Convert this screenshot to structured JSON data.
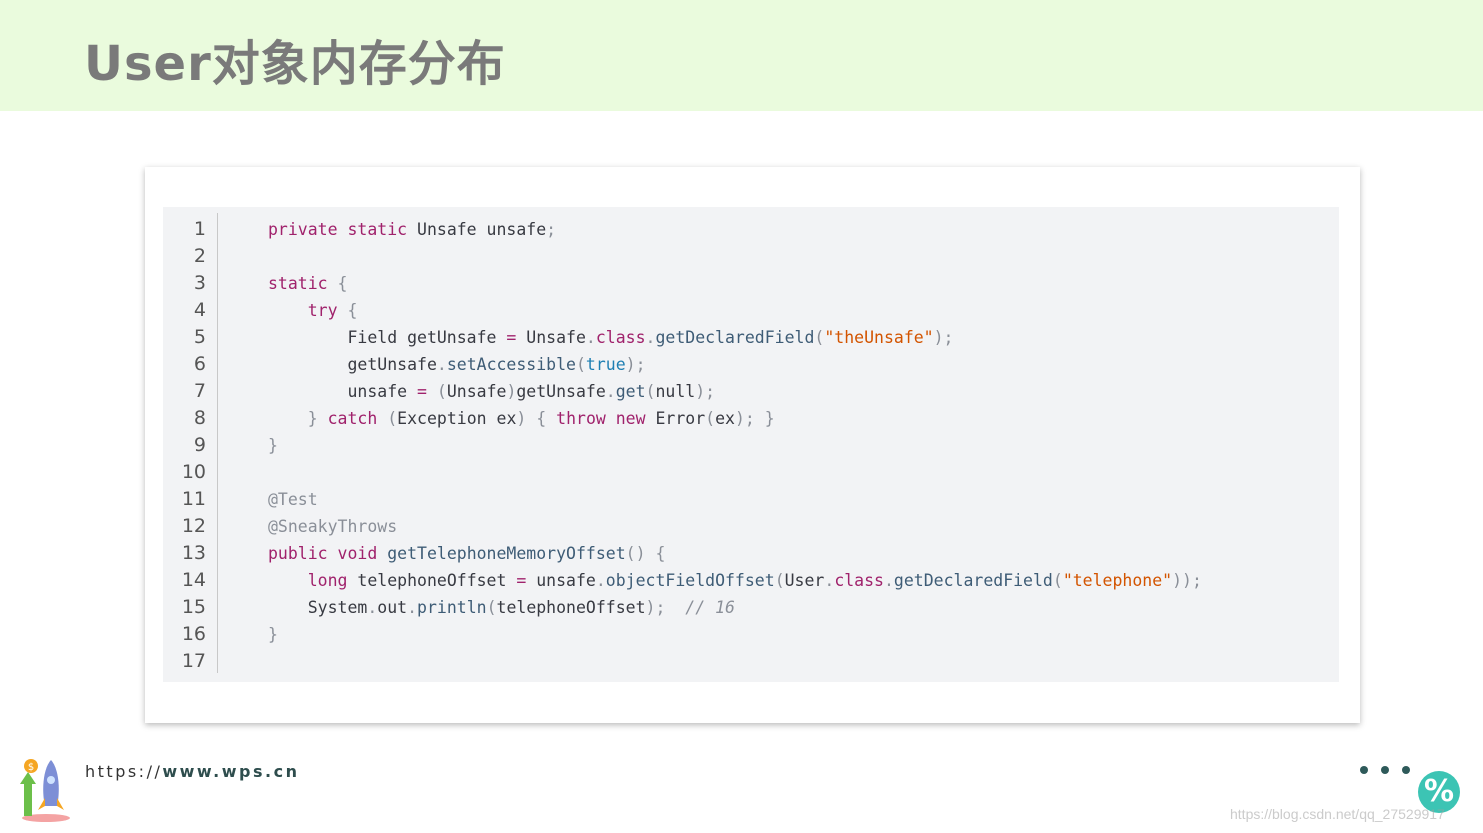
{
  "slide": {
    "title": "User对象内存分布"
  },
  "code": {
    "lines": [
      {
        "n": "1",
        "tokens": [
          [
            "kw",
            "private static "
          ],
          [
            "",
            "Unsafe unsafe"
          ],
          [
            "pn",
            ";"
          ]
        ]
      },
      {
        "n": "2",
        "tokens": []
      },
      {
        "n": "3",
        "tokens": [
          [
            "kw",
            "static "
          ],
          [
            "pn",
            "{"
          ]
        ]
      },
      {
        "n": "4",
        "tokens": [
          [
            "",
            "    "
          ],
          [
            "kw",
            "try "
          ],
          [
            "pn",
            "{"
          ]
        ]
      },
      {
        "n": "5",
        "tokens": [
          [
            "",
            "        Field getUnsafe "
          ],
          [
            "kw",
            "="
          ],
          [
            "",
            " Unsafe"
          ],
          [
            "pn",
            "."
          ],
          [
            "kw",
            "class"
          ],
          [
            "pn",
            "."
          ],
          [
            "fn",
            "getDeclaredField"
          ],
          [
            "pn",
            "("
          ],
          [
            "str",
            "\"theUnsafe\""
          ],
          [
            "pn",
            ");"
          ]
        ]
      },
      {
        "n": "6",
        "tokens": [
          [
            "",
            "        getUnsafe"
          ],
          [
            "pn",
            "."
          ],
          [
            "fn",
            "setAccessible"
          ],
          [
            "pn",
            "("
          ],
          [
            "lit",
            "true"
          ],
          [
            "pn",
            ");"
          ]
        ]
      },
      {
        "n": "7",
        "tokens": [
          [
            "",
            "        unsafe "
          ],
          [
            "kw",
            "="
          ],
          [
            "",
            " "
          ],
          [
            "pn",
            "("
          ],
          [
            "",
            "Unsafe"
          ],
          [
            "pn",
            ")"
          ],
          [
            "",
            "getUnsafe"
          ],
          [
            "pn",
            "."
          ],
          [
            "fn",
            "get"
          ],
          [
            "pn",
            "("
          ],
          [
            "",
            "null"
          ],
          [
            "pn",
            ");"
          ]
        ]
      },
      {
        "n": "8",
        "tokens": [
          [
            "",
            "    "
          ],
          [
            "pn",
            "} "
          ],
          [
            "kw",
            "catch "
          ],
          [
            "pn",
            "("
          ],
          [
            "",
            "Exception ex"
          ],
          [
            "pn",
            ") { "
          ],
          [
            "kw",
            "throw new "
          ],
          [
            "",
            "Error"
          ],
          [
            "pn",
            "("
          ],
          [
            "",
            "ex"
          ],
          [
            "pn",
            "); }"
          ]
        ]
      },
      {
        "n": "9",
        "tokens": [
          [
            "pn",
            "}"
          ]
        ]
      },
      {
        "n": "10",
        "tokens": []
      },
      {
        "n": "11",
        "tokens": [
          [
            "an",
            "@Test"
          ]
        ]
      },
      {
        "n": "12",
        "tokens": [
          [
            "an",
            "@SneakyThrows"
          ]
        ]
      },
      {
        "n": "13",
        "tokens": [
          [
            "kw",
            "public void "
          ],
          [
            "fn",
            "getTelephoneMemoryOffset"
          ],
          [
            "pn",
            "() {"
          ]
        ]
      },
      {
        "n": "14",
        "tokens": [
          [
            "",
            "    "
          ],
          [
            "kw",
            "long "
          ],
          [
            "",
            "telephoneOffset "
          ],
          [
            "kw",
            "="
          ],
          [
            "",
            " unsafe"
          ],
          [
            "pn",
            "."
          ],
          [
            "fn",
            "objectFieldOffset"
          ],
          [
            "pn",
            "("
          ],
          [
            "",
            "User"
          ],
          [
            "pn",
            "."
          ],
          [
            "kw",
            "class"
          ],
          [
            "pn",
            "."
          ],
          [
            "fn",
            "getDeclaredField"
          ],
          [
            "pn",
            "("
          ],
          [
            "str",
            "\"telephone\""
          ],
          [
            "pn",
            "));"
          ]
        ]
      },
      {
        "n": "15",
        "tokens": [
          [
            "",
            "    System"
          ],
          [
            "pn",
            "."
          ],
          [
            "",
            "out"
          ],
          [
            "pn",
            "."
          ],
          [
            "fn",
            "println"
          ],
          [
            "pn",
            "("
          ],
          [
            "",
            "telephoneOffset"
          ],
          [
            "pn",
            ");  "
          ],
          [
            "cm",
            "// 16"
          ]
        ]
      },
      {
        "n": "16",
        "tokens": [
          [
            "pn",
            "}"
          ]
        ]
      },
      {
        "n": "17",
        "tokens": []
      }
    ]
  },
  "footer": {
    "url_prefix": "https://",
    "url_domain": "www.wps.cn",
    "badge_symbol": "%",
    "watermark": "https://blog.csdn.net/qq_27529917"
  },
  "colors": {
    "header_bg": "#eafbdd",
    "title": "#7a7a7a",
    "code_bg": "#f2f3f5",
    "keyword": "#a0226c",
    "string": "#d35400",
    "literal": "#1e7fb3",
    "badge": "#3cc4b4"
  },
  "icons": {
    "logo": "rocket-growth-icon",
    "dots": "more-dots-icon",
    "badge": "percent-icon"
  }
}
